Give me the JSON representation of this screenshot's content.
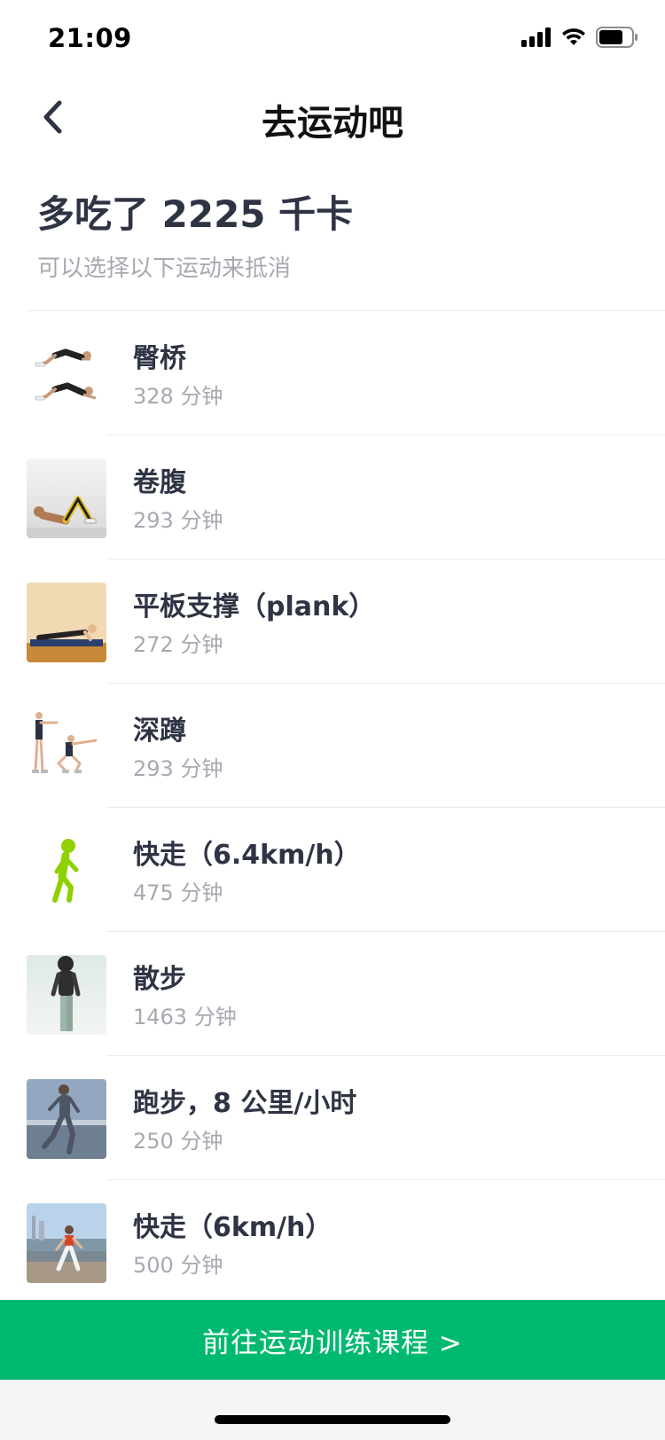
{
  "status_bar": {
    "time": "21:09"
  },
  "nav": {
    "title": "去运动吧"
  },
  "summary": {
    "title": "多吃了 2225 千卡",
    "subtitle": "可以选择以下运动来抵消"
  },
  "exercises": [
    {
      "name": "臀桥",
      "duration": "328 分钟",
      "thumb": "glute-bridge"
    },
    {
      "name": "卷腹",
      "duration": "293 分钟",
      "thumb": "crunch"
    },
    {
      "name": "平板支撑（plank）",
      "duration": "272 分钟",
      "thumb": "plank"
    },
    {
      "name": "深蹲",
      "duration": "293 分钟",
      "thumb": "squat"
    },
    {
      "name": "快走（6.4km/h）",
      "duration": "475 分钟",
      "thumb": "walking-icon"
    },
    {
      "name": "散步",
      "duration": "1463 分钟",
      "thumb": "stroll"
    },
    {
      "name": "跑步，8 公里/小时",
      "duration": "250 分钟",
      "thumb": "running"
    },
    {
      "name": "快走（6km/h）",
      "duration": "500 分钟",
      "thumb": "brisk-walk"
    }
  ],
  "cta": {
    "label": "前往运动训练课程 >"
  },
  "colors": {
    "accent": "#00b970",
    "text_primary": "#2f3444",
    "text_secondary": "#a6a9b2",
    "walk_icon": "#8fd000"
  }
}
